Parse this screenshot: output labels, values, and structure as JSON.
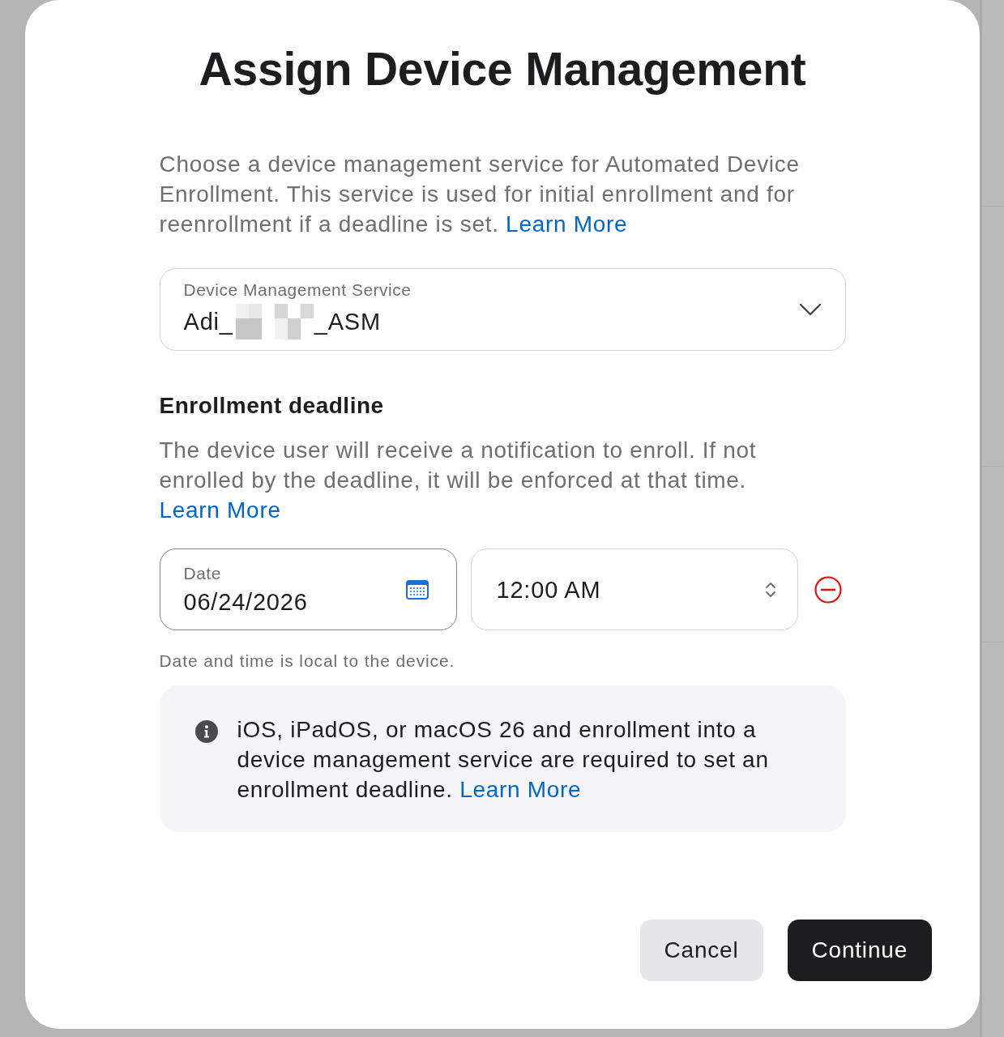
{
  "dialog": {
    "title": "Assign Device Management"
  },
  "intro": {
    "text": "Choose a device management service for Automated Device Enrollment. This service is used for initial enrollment and for reenrollment if a deadline is set.",
    "link": "Learn More"
  },
  "service_field": {
    "label": "Device Management Service",
    "value_start": "Adi_",
    "value_end": "_ASM"
  },
  "deadline": {
    "heading": "Enrollment deadline",
    "text": "The device user will receive a notification to enroll. If not enrolled by the deadline, it will be enforced at that time.",
    "link": "Learn More",
    "date_field": {
      "label": "Date",
      "value": "06/24/2026",
      "focused": true
    },
    "time_field": {
      "value": "12:00 AM",
      "focused": false
    },
    "hint": "Date and time is local to the device."
  },
  "notice": {
    "text": "iOS, iPadOS, or macOS 26 and enrollment into a device management service are required to set an enrollment deadline.",
    "link": "Learn More"
  },
  "buttons": [
    {
      "label": "Cancel",
      "kind": "secondary"
    },
    {
      "label": "Continue",
      "kind": "primary"
    }
  ]
}
